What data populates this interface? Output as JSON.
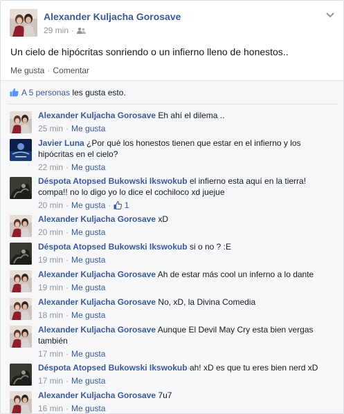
{
  "post": {
    "author": "Alexander Kuljacha Gorosave",
    "time": "29 min",
    "text": "Un cielo de hipócritas sonriendo o un infierno lleno de honestos..",
    "actions": {
      "like": "Me gusta",
      "comment": "Comentar"
    },
    "icons": {
      "audience": "friends-icon",
      "menu": "chevron-down-icon"
    }
  },
  "likes": {
    "count_text": "A 5 personas",
    "suffix": " les gusta esto."
  },
  "comments": [
    {
      "author": "Alexander Kuljacha Gorosave",
      "text": "Eh ahí el dilema ..",
      "time": "25 min",
      "like": "Me gusta",
      "avatar": "alexander"
    },
    {
      "author": "Javier Luna",
      "text": "¿Por qué los honestos tienen que estar en el infierno y los hipócritas en el cielo?",
      "time": "22 min",
      "like": "Me gusta",
      "avatar": "javier"
    },
    {
      "author": "Déspota Atopsed Bukowski Ikswokub",
      "text": "el infierno esta aquí en la tierra! compa!! no lo digo yo lo dice el cochiloco xd juejue",
      "time": "20 min",
      "like": "Me gusta",
      "likes_count": "1",
      "avatar": "despota"
    },
    {
      "author": "Alexander Kuljacha Gorosave",
      "text": "xD",
      "time": "20 min",
      "like": "Me gusta",
      "avatar": "alexander"
    },
    {
      "author": "Déspota Atopsed Bukowski Ikswokub",
      "text": "si o no ? :E",
      "time": "19 min",
      "like": "Me gusta",
      "avatar": "despota"
    },
    {
      "author": "Alexander Kuljacha Gorosave",
      "text": "Ah de estar más cool un inferno a lo dante",
      "time": "19 min",
      "like": "Me gusta",
      "avatar": "alexander"
    },
    {
      "author": "Alexander Kuljacha Gorosave",
      "text": "No, xD, la Divina Comedia",
      "time": "18 min",
      "like": "Me gusta",
      "avatar": "alexander"
    },
    {
      "author": "Alexander Kuljacha Gorosave",
      "text": "Aunque El Devil May Cry esta bien vergas también",
      "time": "17 min",
      "like": "Me gusta",
      "avatar": "alexander"
    },
    {
      "author": "Déspota Atopsed Bukowski Ikswokub",
      "text": "ah! xD es que tu eres bien nerd xD",
      "time": "17 min",
      "like": "Me gusta",
      "avatar": "despota"
    },
    {
      "author": "Alexander Kuljacha Gorosave",
      "text": "7u7",
      "time": "16 min",
      "like": "Me gusta",
      "avatar": "alexander"
    }
  ],
  "colors": {
    "link": "#3b5998",
    "meta": "#90949c",
    "text": "#141823",
    "feedback_bg": "#f6f7f9"
  }
}
